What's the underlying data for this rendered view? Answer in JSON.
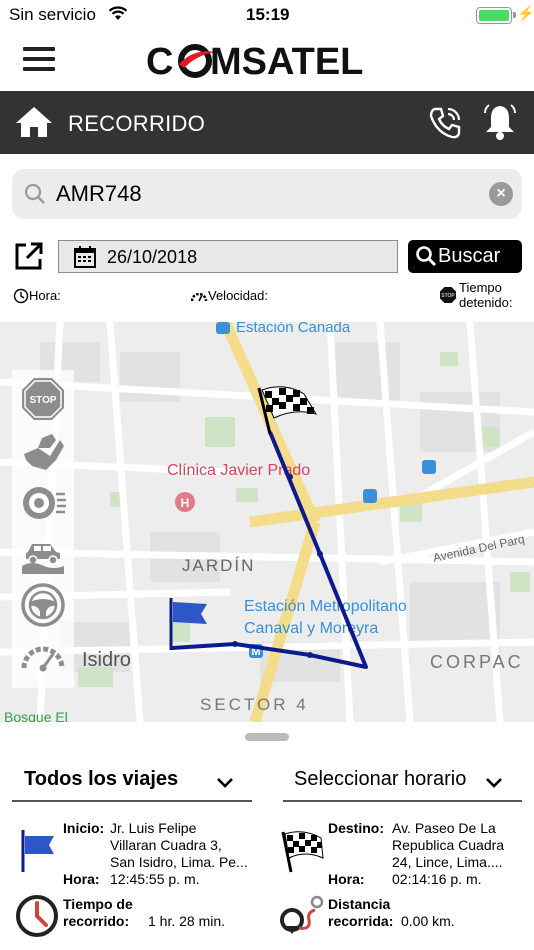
{
  "status_bar": {
    "carrier": "Sin servicio",
    "time": "15:19"
  },
  "app": {
    "brand": "COMSATEL",
    "brand_color": "#e31b23",
    "title": "RECORRIDO"
  },
  "search": {
    "value": "AMR748",
    "clear_icon": "clear-icon"
  },
  "date_filter": {
    "date": "26/10/2018",
    "search_label": "Buscar"
  },
  "metrics": {
    "hora_label": "Hora:",
    "velocidad_label": "Velocidad:",
    "tiempo_detenido_label_line1": "Tiempo",
    "tiempo_detenido_label_line2": "detenido:"
  },
  "map": {
    "labels": {
      "station_canada": "Estación Canada",
      "clinic": "Clínica Javier Prado",
      "jardin": "JARDÍN",
      "station_metro_line1": "Estación Metropolitano",
      "station_metro_line2": "Canaval y Moreyra",
      "isidro": "Isidro",
      "sector4": "SECTOR 4",
      "corpac": "CORPAC",
      "avenida": "Avenida Del Parq",
      "bosque": "Bosque El"
    },
    "route_color": "#0d1a8c",
    "tools": [
      "stop-icon",
      "hard-brake-icon",
      "speed-gauge-icon",
      "vehicle-icon",
      "steering-wheel-icon",
      "speedometer-icon"
    ]
  },
  "selectors": {
    "trips": "Todos los viajes",
    "schedule": "Seleccionar horario"
  },
  "trip": {
    "inicio_label": "Inicio:",
    "inicio_value": [
      "Jr. Luis Felipe",
      "Villaran Cuadra 3,",
      "San Isidro, Lima. Pe..."
    ],
    "hora_label": "Hora:",
    "inicio_hora": "12:45:55 p. m.",
    "destino_label": "Destino:",
    "destino_value": [
      "Av. Paseo De La",
      "Republica Cuadra",
      "24, Lince, Lima...."
    ],
    "destino_hora": "02:14:16 p. m.",
    "tiempo_label": [
      "Tiempo de",
      "recorrido:"
    ],
    "tiempo_value": "1 hr. 28 min.",
    "distancia_label": [
      "Distancia",
      "recorrida:"
    ],
    "distancia_value": "0.00 km."
  }
}
